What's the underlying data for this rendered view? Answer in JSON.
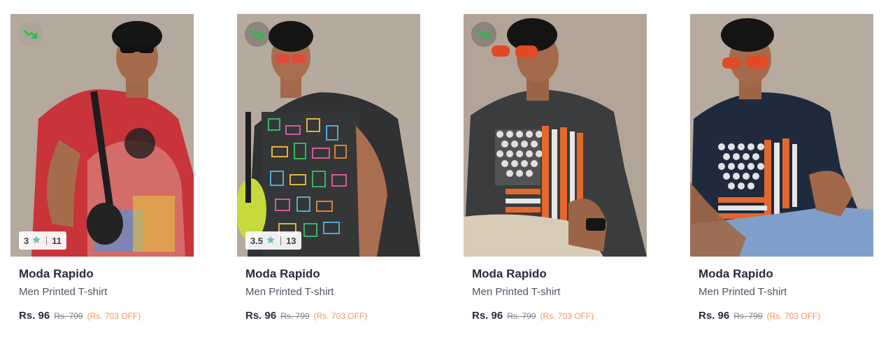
{
  "colors": {
    "brand_text": "#282c3f",
    "product_text": "#535766",
    "mrp_text": "#7e818c",
    "discount_text": "#ff905a",
    "trend_icon": "#14c73c",
    "rating_star": "#72bfbc"
  },
  "products": [
    {
      "brand": "Moda Rapido",
      "name": "Men Printed T-shirt",
      "price": "Rs. 96",
      "mrp": "Rs. 799",
      "discount": "(Rs. 703 OFF)",
      "rating": "3",
      "rating_count": "11",
      "shirt_color": "#c9333a",
      "trend_icon": "price-drop-icon"
    },
    {
      "brand": "Moda Rapido",
      "name": "Men Printed T-shirt",
      "price": "Rs. 96",
      "mrp": "Rs. 799",
      "discount": "(Rs. 703 OFF)",
      "rating": "3.5",
      "rating_count": "13",
      "shirt_color": "#2f3133",
      "trend_icon": "price-drop-icon"
    },
    {
      "brand": "Moda Rapido",
      "name": "Men Printed T-shirt",
      "price": "Rs. 96",
      "mrp": "Rs. 799",
      "discount": "(Rs. 703 OFF)",
      "shirt_color": "#3b3c3e",
      "trend_icon": "price-drop-icon"
    },
    {
      "brand": "Moda Rapido",
      "name": "Men Printed T-shirt",
      "price": "Rs. 96",
      "mrp": "Rs. 799",
      "discount": "(Rs. 703 OFF)",
      "shirt_color": "#1f2a3d"
    }
  ]
}
